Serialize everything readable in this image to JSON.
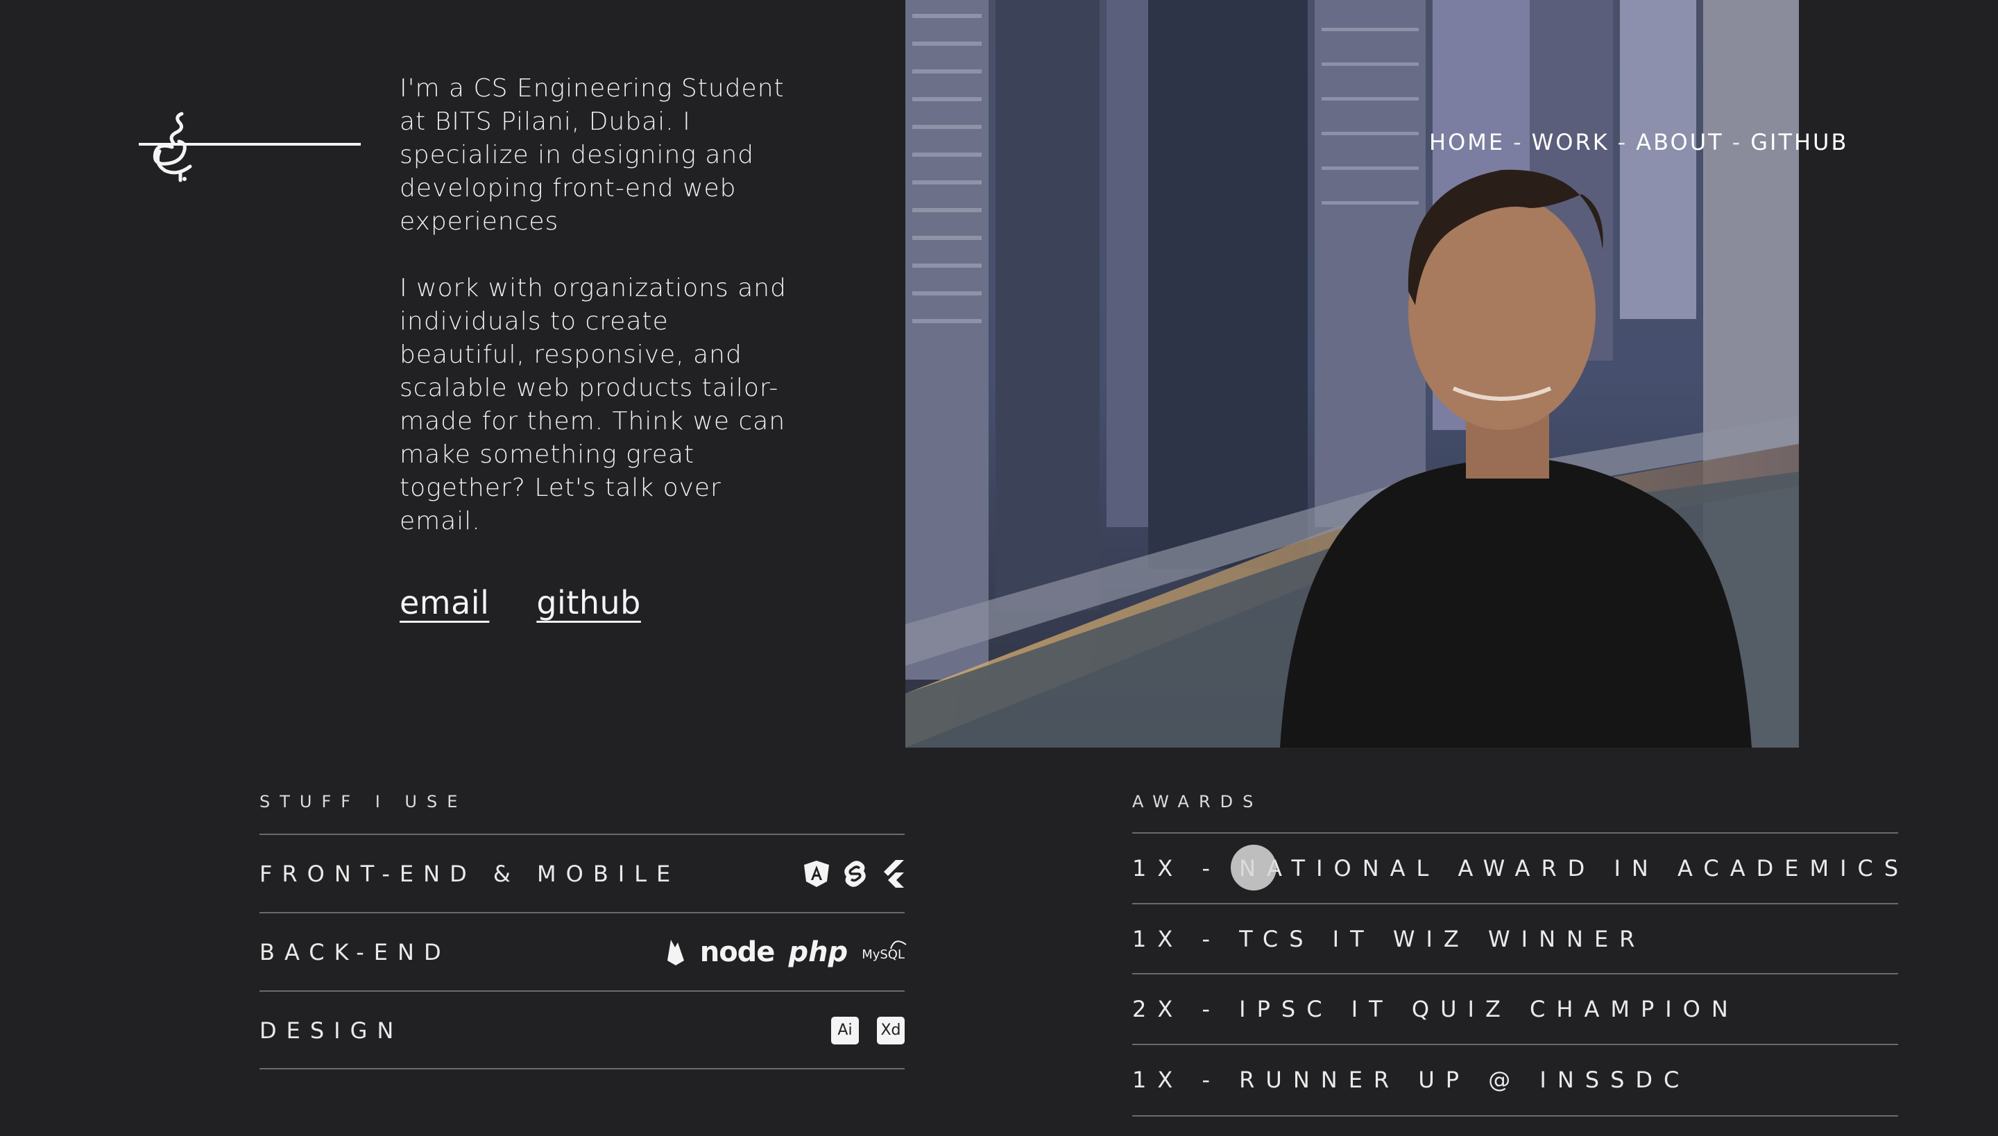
{
  "intro": {
    "paragraph_1": "I'm a CS Engineering Student at BITS Pilani, Dubai. I specialize in designing and developing front-end web experiences",
    "paragraph_2": "I work with organizations and individuals to create beautiful, responsive, and scalable web products tailor-made for them. Think we can make something great together? Let's talk over email.",
    "email_label": "email",
    "github_label": "github"
  },
  "nav": {
    "items": [
      "HOME",
      "WORK",
      "ABOUT",
      "GITHUB"
    ],
    "separator": "-"
  },
  "stuff": {
    "title": "STUFF I USE",
    "rows": [
      {
        "label": "FRONT-END & MOBILE",
        "icons": [
          "angular-icon",
          "svelte-icon",
          "flutter-icon"
        ]
      },
      {
        "label": "BACK-END",
        "icons": [
          "firebase-icon",
          "nodejs-icon",
          "php-icon",
          "mysql-icon"
        ],
        "node_text": "node",
        "php_text": "php",
        "mysql_text": "MySQL"
      },
      {
        "label": "DESIGN",
        "icons": [
          "adobe-illustrator-icon",
          "adobe-xd-icon"
        ],
        "ai_text": "Ai",
        "xd_text": "Xd"
      }
    ]
  },
  "awards": {
    "title": "AWARDS",
    "items": [
      "1X - NATIONAL AWARD IN ACADEMICS",
      "1X - TCS IT WIZ WINNER",
      "2X - IPSC IT QUIZ CHAMPION",
      "1X - RUNNER UP @ INSSDC"
    ]
  },
  "colors": {
    "background": "#212123",
    "text": "#f1f1f1",
    "divider": "#6a6a6c"
  }
}
